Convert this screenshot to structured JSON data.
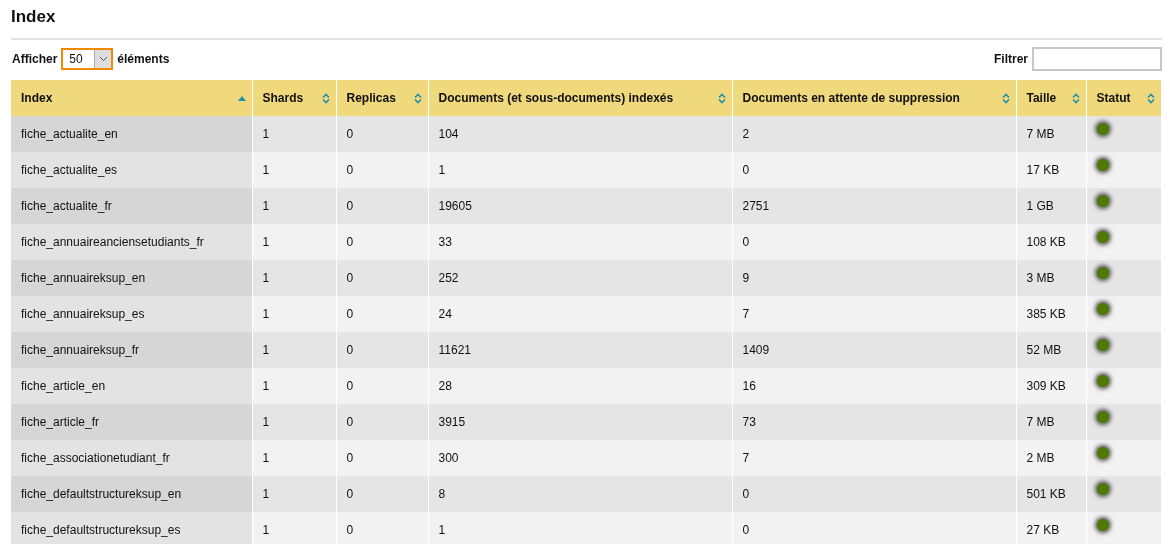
{
  "title": "Index",
  "length_menu": {
    "label_before": "Afficher",
    "value": "50",
    "label_after": "éléments"
  },
  "filter": {
    "label": "Filtrer"
  },
  "table": {
    "columns": [
      {
        "label": "Index",
        "sorted": true
      },
      {
        "label": "Shards",
        "sorted": false
      },
      {
        "label": "Replicas",
        "sorted": false
      },
      {
        "label": "Documents (et sous-documents) indexés",
        "sorted": false
      },
      {
        "label": "Documents en attente de suppression",
        "sorted": false
      },
      {
        "label": "Taille",
        "sorted": false
      },
      {
        "label": "Statut",
        "sorted": false
      }
    ],
    "rows": [
      {
        "cells": [
          "fiche_actualite_en",
          "1",
          "0",
          "104",
          "2",
          "7 MB"
        ],
        "color": "#4e7a00"
      },
      {
        "cells": [
          "fiche_actualite_es",
          "1",
          "0",
          "1",
          "0",
          "17 KB"
        ],
        "color": "#4e7a00"
      },
      {
        "cells": [
          "fiche_actualite_fr",
          "1",
          "0",
          "19605",
          "2751",
          "1 GB"
        ],
        "color": "#4e7a00"
      },
      {
        "cells": [
          "fiche_annuaireanciensetudiants_fr",
          "1",
          "0",
          "33",
          "0",
          "108 KB"
        ],
        "color": "#4e7a00"
      },
      {
        "cells": [
          "fiche_annuaireksup_en",
          "1",
          "0",
          "252",
          "9",
          "3 MB"
        ],
        "color": "#4e7a00"
      },
      {
        "cells": [
          "fiche_annuaireksup_es",
          "1",
          "0",
          "24",
          "7",
          "385 KB"
        ],
        "color": "#4e7a00"
      },
      {
        "cells": [
          "fiche_annuaireksup_fr",
          "1",
          "0",
          "11621",
          "1409",
          "52 MB"
        ],
        "color": "#4e7a00"
      },
      {
        "cells": [
          "fiche_article_en",
          "1",
          "0",
          "28",
          "16",
          "309 KB"
        ],
        "color": "#4e7a00"
      },
      {
        "cells": [
          "fiche_article_fr",
          "1",
          "0",
          "3915",
          "73",
          "7 MB"
        ],
        "color": "#4e7a00"
      },
      {
        "cells": [
          "fiche_associationetudiant_fr",
          "1",
          "0",
          "300",
          "7",
          "2 MB"
        ],
        "color": "#4e7a00"
      },
      {
        "cells": [
          "fiche_defaultstructureksup_en",
          "1",
          "0",
          "8",
          "0",
          "501 KB"
        ],
        "color": "#4e7a00"
      },
      {
        "cells": [
          "fiche_defaultstructureksup_es",
          "1",
          "0",
          "1",
          "0",
          "27 KB"
        ],
        "color": "#4e7a00"
      }
    ]
  }
}
